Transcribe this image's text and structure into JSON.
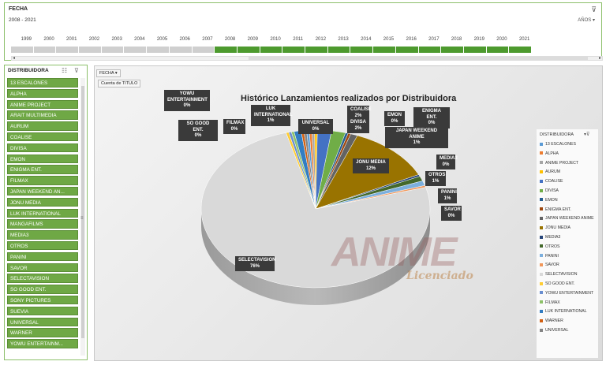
{
  "timeline": {
    "title": "FECHA",
    "range": "2008 - 2021",
    "level": "AÑOS",
    "years": [
      "1999",
      "2000",
      "2001",
      "2002",
      "2003",
      "2004",
      "2005",
      "2006",
      "2007",
      "2008",
      "2009",
      "2010",
      "2011",
      "2012",
      "2013",
      "2014",
      "2015",
      "2016",
      "2017",
      "2018",
      "2019",
      "2020",
      "2021"
    ],
    "selected_from": "2008",
    "selected_to": "2021"
  },
  "slicer": {
    "title": "DISTRIBUIDORA",
    "items": [
      "13 ESCALONES",
      "ALPHA",
      "ANIME PROJECT",
      "ARAIT MULTIMEDIA",
      "AURUM",
      "COALISE",
      "DIVISA",
      "EMON",
      "ENIGMA ENT.",
      "FILMAX",
      "JAPAN WEEKEND AN...",
      "JONU MEDIA",
      "LUK INTERNATIONAL",
      "MANGAFILMS",
      "MEDIA3",
      "OTROS",
      "PANINI",
      "SAVOR",
      "SELECTAVISION",
      "SO GOOD ENT.",
      "SONY PICTURES",
      "SUEVIA",
      "UNIVERSAL",
      "WARNER",
      "YOWU ENTERTAINM..."
    ]
  },
  "pivot": {
    "field_button": "FECHA",
    "value_button": "Cuenta de TITULO"
  },
  "chart_data": {
    "type": "pie",
    "title": "Histórico Lanzamientos realizados por Distribuidora",
    "series_field": "DISTRIBUIDORA",
    "slices": [
      {
        "name": "13 ESCALONES",
        "value": 0,
        "color": "#5b9bd5"
      },
      {
        "name": "ALPHA",
        "value": 0,
        "color": "#ed7d31"
      },
      {
        "name": "ANIME PROJECT",
        "value": 0,
        "color": "#a5a5a5"
      },
      {
        "name": "AURUM",
        "value": 0,
        "color": "#ffc000"
      },
      {
        "name": "COALISE",
        "value": 2,
        "color": "#4472c4"
      },
      {
        "name": "DIVISA",
        "value": 2,
        "color": "#70ad47"
      },
      {
        "name": "EMON",
        "value": 0,
        "color": "#255e91"
      },
      {
        "name": "ENIGMA ENT.",
        "value": 0,
        "color": "#9e480e"
      },
      {
        "name": "JAPAN WEEKEND ANIME",
        "value": 1,
        "color": "#636363"
      },
      {
        "name": "JONU MEDIA",
        "value": 12,
        "color": "#997300"
      },
      {
        "name": "MEDIA3",
        "value": 0,
        "color": "#264478"
      },
      {
        "name": "OTROS",
        "value": 1,
        "color": "#43682b"
      },
      {
        "name": "PANINI",
        "value": 1,
        "color": "#7cafdd"
      },
      {
        "name": "SAVOR",
        "value": 0,
        "color": "#f1975a"
      },
      {
        "name": "SELECTAVISION",
        "value": 76,
        "color": "#d9d9d9"
      },
      {
        "name": "SO GOOD ENT.",
        "value": 0,
        "color": "#ffcd33"
      },
      {
        "name": "YOWU ENTERTAINMENT",
        "value": 0,
        "color": "#698ed0"
      },
      {
        "name": "FILMAX",
        "value": 0,
        "color": "#8cc168"
      },
      {
        "name": "LUK INTERNATIONAL",
        "value": 1,
        "color": "#327dc2"
      },
      {
        "name": "WARNER",
        "value": 0,
        "color": "#d26012"
      },
      {
        "name": "UNIVERSAL",
        "value": 0,
        "color": "#848484"
      }
    ],
    "labels": [
      {
        "name": "YOWU\nENTERTAINMENT",
        "pct": "0%"
      },
      {
        "name": "SO GOOD ENT.",
        "pct": "0%"
      },
      {
        "name": "FILMAX",
        "pct": "0%"
      },
      {
        "name": "LUK\nINTERNATIONAL",
        "pct": "1%"
      },
      {
        "name": "UNIVERSAL",
        "pct": "0%"
      },
      {
        "name": "COALISE",
        "pct": "2%"
      },
      {
        "name": "DIVISA",
        "pct": "2%"
      },
      {
        "name": "EMON",
        "pct": "0%"
      },
      {
        "name": "ENIGMA ENT.",
        "pct": "0%"
      },
      {
        "name": "JAPAN WEEKEND ANIME",
        "pct": "1%"
      },
      {
        "name": "JONU MEDIA",
        "pct": "12%"
      },
      {
        "name": "MEDIA3",
        "pct": "0%"
      },
      {
        "name": "OTROS",
        "pct": "1%"
      },
      {
        "name": "PANINI",
        "pct": "1%"
      },
      {
        "name": "SAVOR",
        "pct": "0%"
      },
      {
        "name": "SELECTAVISION",
        "pct": "76%"
      }
    ],
    "legend_title": "DISTRIBUIDORA",
    "legend": [
      "13 ESCALONES",
      "ALPHA",
      "ANIME PROJECT",
      "AURUM",
      "COALISE",
      "DIVISA",
      "EMON",
      "ENIGMA ENT.",
      "JAPAN WEEKEND ANIME",
      "JONU MEDIA",
      "MEDIA3",
      "OTROS",
      "PANINI",
      "SAVOR",
      "SELECTAVISION",
      "SO GOOD ENT.",
      "YOWU ENTERTAINMENT",
      "FILMAX",
      "LUK INTERNATIONAL",
      "WARNER",
      "UNIVERSAL"
    ],
    "legend_placement": "right"
  },
  "watermark": {
    "main": "ANIME",
    "sub": "Licenciado"
  }
}
